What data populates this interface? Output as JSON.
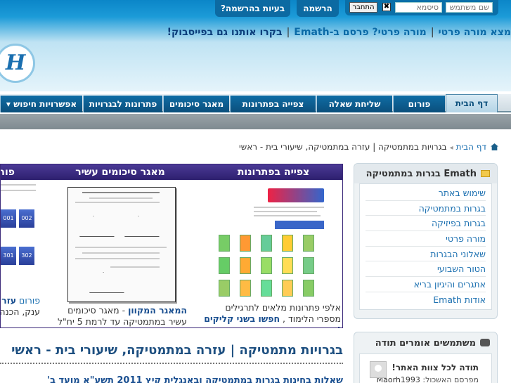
{
  "login": {
    "username_placeholder": "שם משתמש",
    "password_placeholder": "סיסמא",
    "connect": "התחבר",
    "close": "✖"
  },
  "top_tabs": {
    "register": "הרשמה",
    "problems": "בעיות בהרשמה?"
  },
  "promo": {
    "find_teacher": "מצא מורה פרטי",
    "private_teacher": "מורה פרטי? פרסם ב-Emath",
    "facebook": "בקרו אותנו גם בפייסבוק!"
  },
  "logo": {
    "text": "H"
  },
  "nav": {
    "home": "דף הבית",
    "forum": "פורום",
    "ask": "שליחת שאלה",
    "solutions": "צפייה בפתרונות",
    "summaries": "מאגר סיכומים",
    "grades": "פתרונות לבגרויות",
    "search": "אפשרויות חיפוש"
  },
  "breadcrumb": {
    "home": "דף הבית",
    "current": "בגרויות במתמטיקה | עזרה במתמטיקה, שיעורי בית - ראשי"
  },
  "sidebar": {
    "title": "Emath בגרות במתמטיקה",
    "items": [
      "שימוש באתר",
      "בגרות במתמטיקה",
      "בגרות בפיזיקה",
      "מורה פרטי",
      "שאלוני הבגרות",
      "הטור השבועי",
      "אתגרים והיגיון בריא",
      "אודות Emath"
    ]
  },
  "thanks": {
    "title": "משתמשים אומרים תודה",
    "msg": "תודה לכל צוות האתר!",
    "poster_label": "מפרסם האשכול:",
    "poster": "Maorh1993"
  },
  "feature": {
    "solutions_title": "צפייה בפתרונות",
    "summaries_title": "מאגר סיכומים עשיר",
    "forum_title": "פורום",
    "sol_caption": "אלפי פתרונות מלאים לתרגילים מספרי הלימוד ,",
    "sol_link": "חפשו בשני קליקים !",
    "sum_caption_hl": "המאגר המקוון",
    "sum_caption": " - מאגר סיכומים עשיר במתמטיקה עד לרמת 5 יח\"ל",
    "forum_caption_link": "פורום",
    "forum_caption_hl": "עזרה",
    "forum_caption2": "ענק, הכנה",
    "tiles": [
      "001",
      "002",
      "301",
      "302"
    ]
  },
  "main": {
    "title": "בגרויות מתמטיקה | עזרה במתמטיקה, שיעורי בית - ראשי",
    "subtitle": "שאלות בחינות בגרות במתמטיקה ובאנגלית קיץ 2011 תשע\"א מועד ב'"
  }
}
